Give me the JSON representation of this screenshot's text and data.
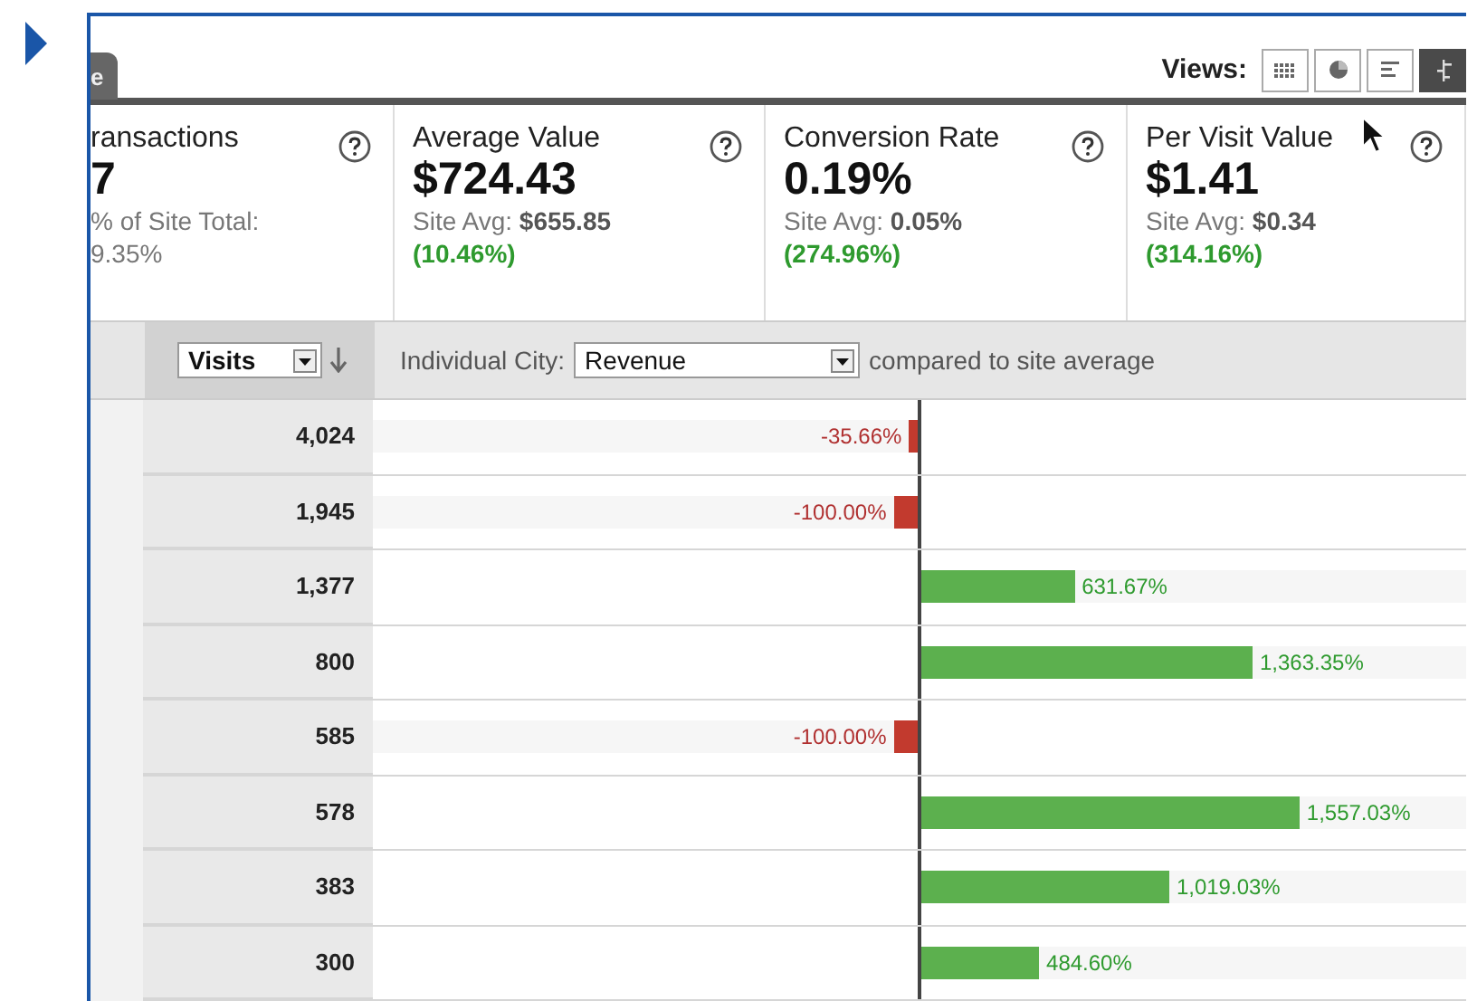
{
  "tab": {
    "label": "e"
  },
  "views": {
    "label": "Views:",
    "buttons": [
      {
        "kind": "table",
        "selected": false
      },
      {
        "kind": "pie",
        "selected": false
      },
      {
        "kind": "bars",
        "selected": false
      },
      {
        "kind": "compare",
        "selected": true
      }
    ]
  },
  "metrics": [
    {
      "title": "ransactions",
      "value": "7",
      "caption": "% of Site Total:",
      "change": "9.35%",
      "color": "#777777"
    },
    {
      "title": "Average Value",
      "value": "$724.43",
      "caption": "Site Avg: **$655.85**",
      "change": "(10.46%)",
      "color": "#2e9a2e"
    },
    {
      "title": "Conversion Rate",
      "value": "0.19%",
      "caption": "Site Avg: **0.05%**",
      "change": "(274.96%)",
      "color": "#2e9a2e"
    },
    {
      "title": "Per Visit Value",
      "value": "$1.41",
      "caption": "Site Avg: **$0.34**",
      "change": "(314.16%)",
      "color": "#2e9a2e"
    }
  ],
  "toolbar": {
    "sort_select": "Visits",
    "dimension_label": "Individual City:",
    "metric_select": "Revenue",
    "suffix": "compared to site average"
  },
  "rows": [
    {
      "visits": "4,024",
      "kind": "decrease",
      "level": 0.016,
      "change": "-35.66%"
    },
    {
      "visits": "1,945",
      "kind": "decrease",
      "level": 0.044,
      "change": "-100.00%"
    },
    {
      "visits": "1,377",
      "kind": "increase",
      "level": 0.281,
      "change": "631.67%"
    },
    {
      "visits": "800",
      "kind": "increase",
      "level": 0.608,
      "change": "1,363.35%"
    },
    {
      "visits": "585",
      "kind": "decrease",
      "level": 0.044,
      "change": "-100.00%"
    },
    {
      "visits": "578",
      "kind": "increase",
      "level": 0.694,
      "change": "1,557.03%"
    },
    {
      "visits": "383",
      "kind": "increase",
      "level": 0.455,
      "change": "1,019.03%"
    },
    {
      "visits": "300",
      "kind": "increase",
      "level": 0.216,
      "change": "484.60%"
    }
  ]
}
